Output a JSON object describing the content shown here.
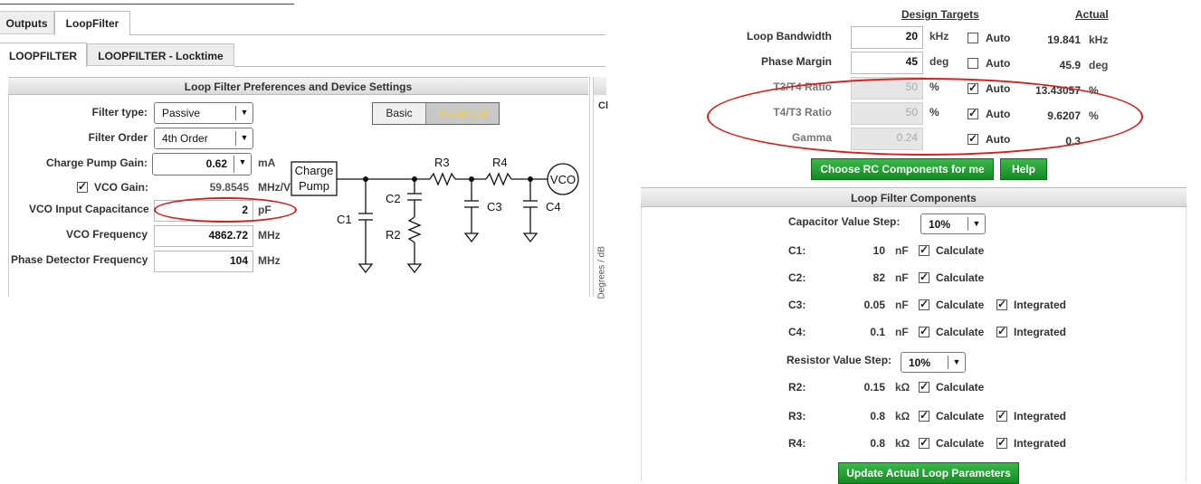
{
  "top_tabs": [
    "Outputs",
    "LoopFilter"
  ],
  "sub_tabs": [
    "LOOPFILTER",
    "LOOPFILTER - Locktime"
  ],
  "prefs_header": "Loop Filter Preferences and Device Settings",
  "side_cut_letter": "Cl",
  "side_cut_axis": "Degrees / dB",
  "mode_buttons": {
    "basic": "Basic",
    "advanced": "Advanced"
  },
  "settings": {
    "filter_type": {
      "label": "Filter type:",
      "value": "Passive"
    },
    "filter_order": {
      "label": "Filter Order",
      "value": "4th Order"
    },
    "charge_pump_gain": {
      "label": "Charge Pump Gain:",
      "value": "0.62",
      "unit": "mA"
    },
    "vco_gain": {
      "label": "VCO Gain:",
      "value": "59.8545",
      "unit": "MHz/V",
      "checked": true
    },
    "vco_input_cap": {
      "label": "VCO Input Capacitance",
      "value": "2",
      "unit": "pF"
    },
    "vco_freq": {
      "label": "VCO Frequency",
      "value": "4862.72",
      "unit": "MHz"
    },
    "pd_freq": {
      "label": "Phase Detector Frequency",
      "value": "104",
      "unit": "MHz"
    }
  },
  "schematic": {
    "charge_pump_line1": "Charge",
    "charge_pump_line2": "Pump",
    "vco": "VCO",
    "labels": [
      "C1",
      "C2",
      "R2",
      "R3",
      "C3",
      "R4",
      "C4"
    ]
  },
  "targets": {
    "design_header": "Design Targets",
    "actual_header": "Actual",
    "rows": [
      {
        "label": "Loop Bandwidth",
        "value": "20",
        "unit": "kHz",
        "auto": "Auto",
        "auto_checked": false,
        "actual": "19.841",
        "actual_unit": "kHz",
        "disabled": false
      },
      {
        "label": "Phase Margin",
        "value": "45",
        "unit": "deg",
        "auto": "Auto",
        "auto_checked": false,
        "actual": "45.9",
        "actual_unit": "deg",
        "disabled": false
      },
      {
        "label": "T3/T4 Ratio",
        "value": "50",
        "unit": "%",
        "auto": "Auto",
        "auto_checked": true,
        "actual": "13.43057",
        "actual_unit": "%",
        "disabled": true
      },
      {
        "label": "T4/T3 Ratio",
        "value": "50",
        "unit": "%",
        "auto": "Auto",
        "auto_checked": true,
        "actual": "9.6207",
        "actual_unit": "%",
        "disabled": true
      },
      {
        "label": "Gamma",
        "value": "0.24",
        "unit": "",
        "auto": "Auto",
        "auto_checked": true,
        "actual": "0.3",
        "actual_unit": "",
        "disabled": true
      }
    ],
    "choose_btn": "Choose RC Components for me",
    "help_btn": "Help"
  },
  "components": {
    "header": "Loop Filter Components",
    "cap_step_label": "Capacitor Value Step:",
    "cap_step_value": "10%",
    "res_step_label": "Resistor Value Step:",
    "res_step_value": "10%",
    "calculate": "Calculate",
    "integrated": "Integrated",
    "caps": [
      {
        "name": "C1:",
        "value": "10",
        "unit": "nF",
        "integrated": false
      },
      {
        "name": "C2:",
        "value": "82",
        "unit": "nF",
        "integrated": false
      },
      {
        "name": "C3:",
        "value": "0.05",
        "unit": "nF",
        "integrated": true
      },
      {
        "name": "C4:",
        "value": "0.1",
        "unit": "nF",
        "integrated": true
      }
    ],
    "res": [
      {
        "name": "R2:",
        "value": "0.15",
        "unit": "kΩ",
        "integrated": false
      },
      {
        "name": "R3:",
        "value": "0.8",
        "unit": "kΩ",
        "integrated": true
      },
      {
        "name": "R4:",
        "value": "0.8",
        "unit": "kΩ",
        "integrated": true
      }
    ],
    "update_btn": "Update Actual Loop Parameters"
  }
}
